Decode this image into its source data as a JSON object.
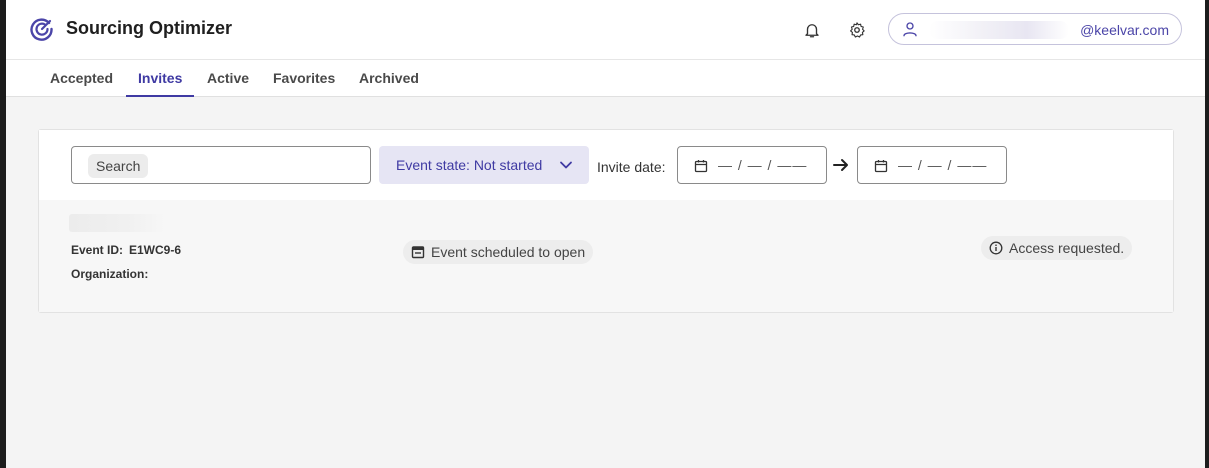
{
  "header": {
    "app_title": "Sourcing Optimizer",
    "logo_icon": "sourcing-optimizer-logo",
    "notifications_icon": "bell-icon",
    "settings_icon": "gear-icon",
    "user": {
      "icon": "user-icon",
      "email_domain": "@keelvar.com"
    }
  },
  "tabs": [
    {
      "label": "Accepted",
      "active": false
    },
    {
      "label": "Invites",
      "active": true
    },
    {
      "label": "Active",
      "active": false
    },
    {
      "label": "Favorites",
      "active": false
    },
    {
      "label": "Archived",
      "active": false
    }
  ],
  "filters": {
    "search_label": "Search",
    "event_state_label": "Event state: Not started",
    "invite_date_label": "Invite date:",
    "date_from_placeholder": "— / — / ——",
    "date_to_placeholder": "— / — / ——"
  },
  "event": {
    "event_id_label": "Event ID:",
    "event_id_value": "E1WC9-6",
    "organization_label": "Organization:",
    "status_chip": "Event scheduled to open",
    "access_chip": "Access requested."
  },
  "colors": {
    "accent": "#3f3aa3",
    "accent_light": "#e6e5f4",
    "page_bg": "#f4f4f4"
  }
}
